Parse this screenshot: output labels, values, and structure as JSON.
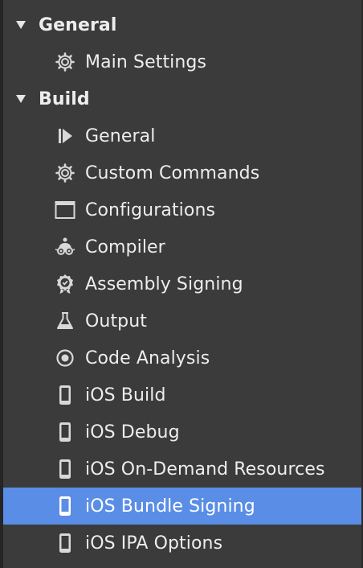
{
  "sections": [
    {
      "label": "General",
      "expanded": true,
      "items": [
        {
          "label": "Main Settings",
          "icon": "gear-icon"
        }
      ]
    },
    {
      "label": "Build",
      "expanded": true,
      "items": [
        {
          "label": "General",
          "icon": "play-bar-icon"
        },
        {
          "label": "Custom Commands",
          "icon": "gear-icon"
        },
        {
          "label": "Configurations",
          "icon": "window-icon"
        },
        {
          "label": "Compiler",
          "icon": "robot-icon"
        },
        {
          "label": "Assembly Signing",
          "icon": "seal-icon"
        },
        {
          "label": "Output",
          "icon": "flask-icon"
        },
        {
          "label": "Code Analysis",
          "icon": "radio-dot-icon"
        },
        {
          "label": "iOS Build",
          "icon": "phone-icon"
        },
        {
          "label": "iOS Debug",
          "icon": "phone-icon"
        },
        {
          "label": "iOS On-Demand Resources",
          "icon": "phone-icon"
        },
        {
          "label": "iOS Bundle Signing",
          "icon": "phone-icon",
          "selected": true
        },
        {
          "label": "iOS IPA Options",
          "icon": "phone-icon"
        }
      ]
    }
  ],
  "colors": {
    "background": "#3b3b3b",
    "selected": "#5a8ee6",
    "text": "#ededed"
  }
}
